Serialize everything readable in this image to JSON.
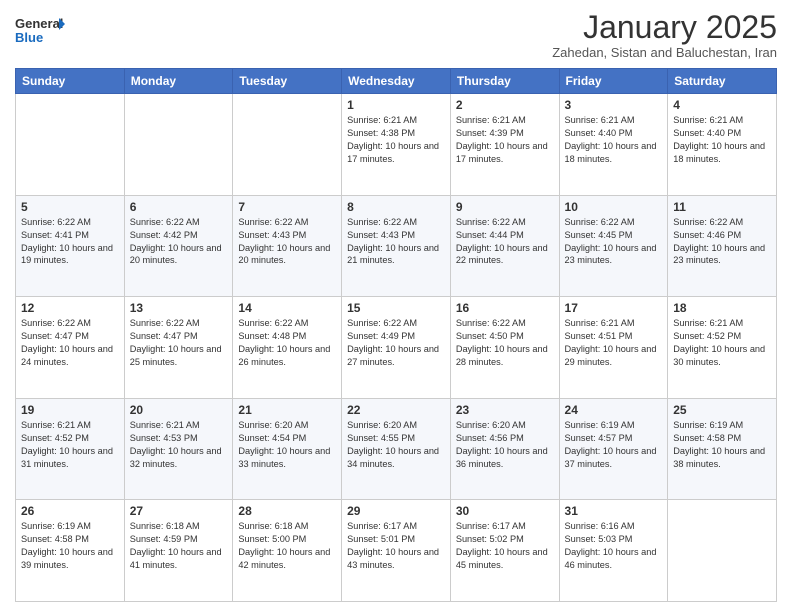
{
  "logo": {
    "general": "General",
    "blue": "Blue"
  },
  "header": {
    "month_year": "January 2025",
    "location": "Zahedan, Sistan and Baluchestan, Iran"
  },
  "weekdays": [
    "Sunday",
    "Monday",
    "Tuesday",
    "Wednesday",
    "Thursday",
    "Friday",
    "Saturday"
  ],
  "weeks": [
    {
      "days": [
        {
          "num": "",
          "info": ""
        },
        {
          "num": "",
          "info": ""
        },
        {
          "num": "",
          "info": ""
        },
        {
          "num": "1",
          "sunrise": "Sunrise: 6:21 AM",
          "sunset": "Sunset: 4:38 PM",
          "daylight": "Daylight: 10 hours and 17 minutes."
        },
        {
          "num": "2",
          "sunrise": "Sunrise: 6:21 AM",
          "sunset": "Sunset: 4:39 PM",
          "daylight": "Daylight: 10 hours and 17 minutes."
        },
        {
          "num": "3",
          "sunrise": "Sunrise: 6:21 AM",
          "sunset": "Sunset: 4:40 PM",
          "daylight": "Daylight: 10 hours and 18 minutes."
        },
        {
          "num": "4",
          "sunrise": "Sunrise: 6:21 AM",
          "sunset": "Sunset: 4:40 PM",
          "daylight": "Daylight: 10 hours and 18 minutes."
        }
      ]
    },
    {
      "days": [
        {
          "num": "5",
          "sunrise": "Sunrise: 6:22 AM",
          "sunset": "Sunset: 4:41 PM",
          "daylight": "Daylight: 10 hours and 19 minutes."
        },
        {
          "num": "6",
          "sunrise": "Sunrise: 6:22 AM",
          "sunset": "Sunset: 4:42 PM",
          "daylight": "Daylight: 10 hours and 20 minutes."
        },
        {
          "num": "7",
          "sunrise": "Sunrise: 6:22 AM",
          "sunset": "Sunset: 4:43 PM",
          "daylight": "Daylight: 10 hours and 20 minutes."
        },
        {
          "num": "8",
          "sunrise": "Sunrise: 6:22 AM",
          "sunset": "Sunset: 4:43 PM",
          "daylight": "Daylight: 10 hours and 21 minutes."
        },
        {
          "num": "9",
          "sunrise": "Sunrise: 6:22 AM",
          "sunset": "Sunset: 4:44 PM",
          "daylight": "Daylight: 10 hours and 22 minutes."
        },
        {
          "num": "10",
          "sunrise": "Sunrise: 6:22 AM",
          "sunset": "Sunset: 4:45 PM",
          "daylight": "Daylight: 10 hours and 23 minutes."
        },
        {
          "num": "11",
          "sunrise": "Sunrise: 6:22 AM",
          "sunset": "Sunset: 4:46 PM",
          "daylight": "Daylight: 10 hours and 23 minutes."
        }
      ]
    },
    {
      "days": [
        {
          "num": "12",
          "sunrise": "Sunrise: 6:22 AM",
          "sunset": "Sunset: 4:47 PM",
          "daylight": "Daylight: 10 hours and 24 minutes."
        },
        {
          "num": "13",
          "sunrise": "Sunrise: 6:22 AM",
          "sunset": "Sunset: 4:47 PM",
          "daylight": "Daylight: 10 hours and 25 minutes."
        },
        {
          "num": "14",
          "sunrise": "Sunrise: 6:22 AM",
          "sunset": "Sunset: 4:48 PM",
          "daylight": "Daylight: 10 hours and 26 minutes."
        },
        {
          "num": "15",
          "sunrise": "Sunrise: 6:22 AM",
          "sunset": "Sunset: 4:49 PM",
          "daylight": "Daylight: 10 hours and 27 minutes."
        },
        {
          "num": "16",
          "sunrise": "Sunrise: 6:22 AM",
          "sunset": "Sunset: 4:50 PM",
          "daylight": "Daylight: 10 hours and 28 minutes."
        },
        {
          "num": "17",
          "sunrise": "Sunrise: 6:21 AM",
          "sunset": "Sunset: 4:51 PM",
          "daylight": "Daylight: 10 hours and 29 minutes."
        },
        {
          "num": "18",
          "sunrise": "Sunrise: 6:21 AM",
          "sunset": "Sunset: 4:52 PM",
          "daylight": "Daylight: 10 hours and 30 minutes."
        }
      ]
    },
    {
      "days": [
        {
          "num": "19",
          "sunrise": "Sunrise: 6:21 AM",
          "sunset": "Sunset: 4:52 PM",
          "daylight": "Daylight: 10 hours and 31 minutes."
        },
        {
          "num": "20",
          "sunrise": "Sunrise: 6:21 AM",
          "sunset": "Sunset: 4:53 PM",
          "daylight": "Daylight: 10 hours and 32 minutes."
        },
        {
          "num": "21",
          "sunrise": "Sunrise: 6:20 AM",
          "sunset": "Sunset: 4:54 PM",
          "daylight": "Daylight: 10 hours and 33 minutes."
        },
        {
          "num": "22",
          "sunrise": "Sunrise: 6:20 AM",
          "sunset": "Sunset: 4:55 PM",
          "daylight": "Daylight: 10 hours and 34 minutes."
        },
        {
          "num": "23",
          "sunrise": "Sunrise: 6:20 AM",
          "sunset": "Sunset: 4:56 PM",
          "daylight": "Daylight: 10 hours and 36 minutes."
        },
        {
          "num": "24",
          "sunrise": "Sunrise: 6:19 AM",
          "sunset": "Sunset: 4:57 PM",
          "daylight": "Daylight: 10 hours and 37 minutes."
        },
        {
          "num": "25",
          "sunrise": "Sunrise: 6:19 AM",
          "sunset": "Sunset: 4:58 PM",
          "daylight": "Daylight: 10 hours and 38 minutes."
        }
      ]
    },
    {
      "days": [
        {
          "num": "26",
          "sunrise": "Sunrise: 6:19 AM",
          "sunset": "Sunset: 4:58 PM",
          "daylight": "Daylight: 10 hours and 39 minutes."
        },
        {
          "num": "27",
          "sunrise": "Sunrise: 6:18 AM",
          "sunset": "Sunset: 4:59 PM",
          "daylight": "Daylight: 10 hours and 41 minutes."
        },
        {
          "num": "28",
          "sunrise": "Sunrise: 6:18 AM",
          "sunset": "Sunset: 5:00 PM",
          "daylight": "Daylight: 10 hours and 42 minutes."
        },
        {
          "num": "29",
          "sunrise": "Sunrise: 6:17 AM",
          "sunset": "Sunset: 5:01 PM",
          "daylight": "Daylight: 10 hours and 43 minutes."
        },
        {
          "num": "30",
          "sunrise": "Sunrise: 6:17 AM",
          "sunset": "Sunset: 5:02 PM",
          "daylight": "Daylight: 10 hours and 45 minutes."
        },
        {
          "num": "31",
          "sunrise": "Sunrise: 6:16 AM",
          "sunset": "Sunset: 5:03 PM",
          "daylight": "Daylight: 10 hours and 46 minutes."
        },
        {
          "num": "",
          "info": ""
        }
      ]
    }
  ]
}
